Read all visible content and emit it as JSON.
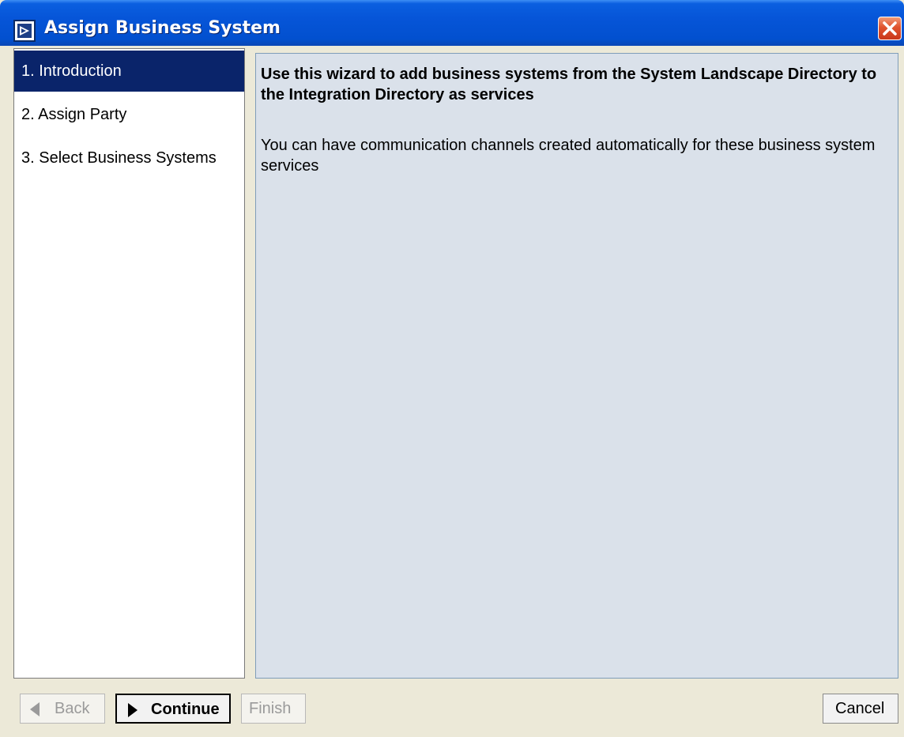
{
  "window": {
    "title": "Assign Business System",
    "icons": {
      "app": "wizard-window-icon",
      "close": "close-icon"
    },
    "colors": {
      "titlebar": "#0055e5",
      "close": "#e0532e"
    }
  },
  "steps": [
    {
      "label": "1. Introduction",
      "active": true
    },
    {
      "label": "2. Assign Party",
      "active": false
    },
    {
      "label": "3. Select Business Systems",
      "active": false
    }
  ],
  "content": {
    "heading": "Use this wizard to add business systems from the System Landscape Directory to the Integration Directory as services",
    "body": "You can have communication channels created automatically for these business system services",
    "background_color": "#dae1ea"
  },
  "buttons": {
    "back": {
      "label": "Back",
      "enabled": false,
      "icon": "triangle-left-icon"
    },
    "continue": {
      "label": "Continue",
      "enabled": true,
      "default": true,
      "icon": "triangle-right-icon"
    },
    "finish": {
      "label": "Finish",
      "enabled": false
    },
    "cancel": {
      "label": "Cancel",
      "enabled": true
    }
  },
  "colors": {
    "active_step_bg": "#0a246a",
    "dialog_bg": "#ece9d8"
  }
}
